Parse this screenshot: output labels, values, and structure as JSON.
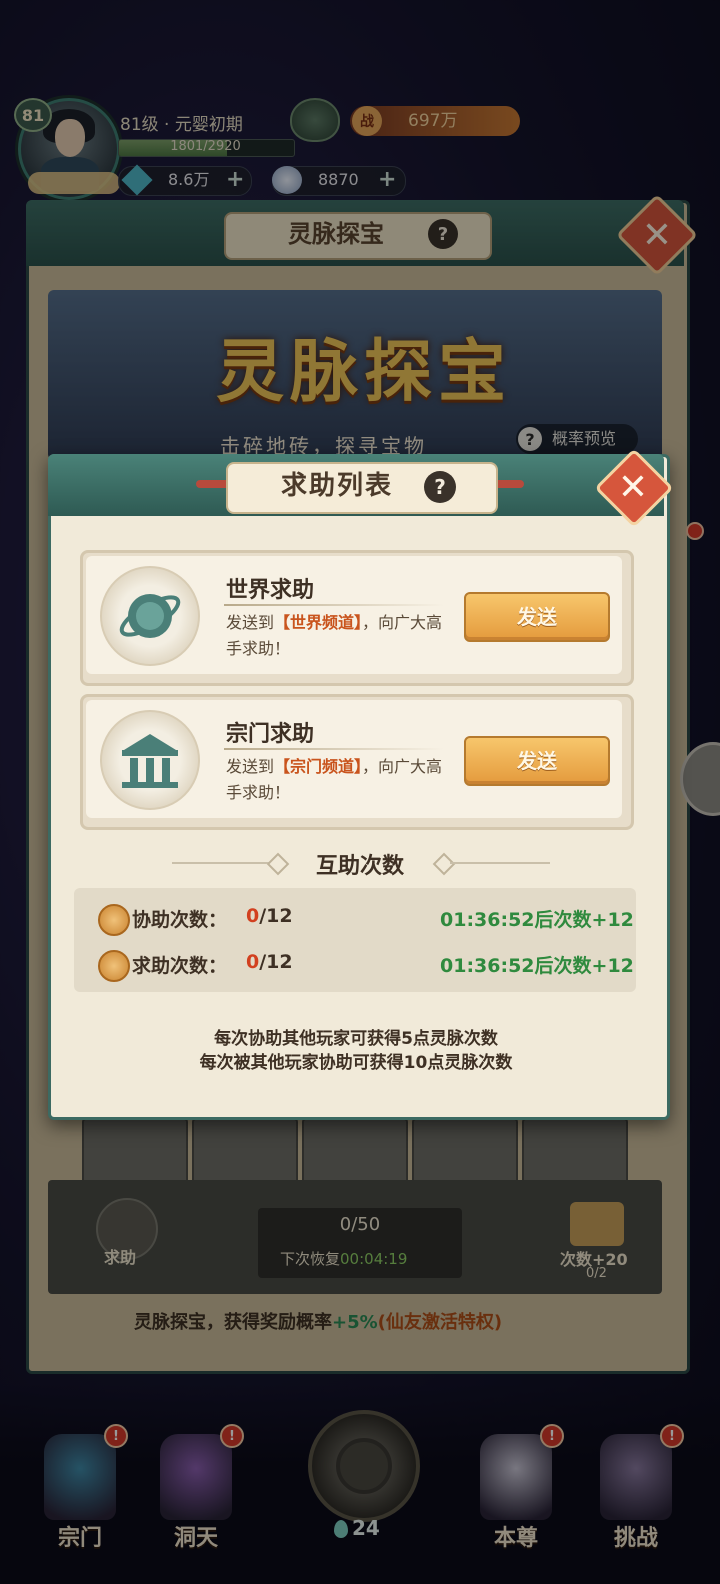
{
  "player": {
    "level_badge": "81",
    "level_text": "81级 · 元婴初期",
    "exp": {
      "current": 1801,
      "max": 2920,
      "label": "1801/2920"
    },
    "power_icon_text": "战",
    "power": "697万",
    "gems": "8.6万",
    "coins": "8870",
    "plus": "+"
  },
  "background_panel": {
    "title": "灵脉探宝",
    "help": "?",
    "close": "✕",
    "banner_title": "灵脉探宝",
    "banner_subtitle": "击碎地砖，探寻宝物",
    "prob_help": "?",
    "prob_label": "概率预览",
    "help_label": "求助",
    "counter": "0/50",
    "next_restore_label": "下次恢复",
    "next_restore_time": "00:04:19",
    "video_label": "次数+20",
    "video_sub": "0/2",
    "bonus_prefix": "灵脉探宝，获得奖励概率",
    "bonus_value": "+5%",
    "bonus_privilege": "(仙友激活特权)"
  },
  "modal": {
    "title": "求助列表",
    "help": "?",
    "close": "✕",
    "cards": [
      {
        "title": "世界求助",
        "desc_prefix": "发送到",
        "channel": "【世界频道】",
        "desc_suffix": "，向广大高手求助！",
        "button": "发送",
        "icon": "planet-icon"
      },
      {
        "title": "宗门求助",
        "desc_prefix": "发送到",
        "channel": "【宗门频道】",
        "desc_suffix": "，向广大高手求助！",
        "button": "发送",
        "icon": "pavilion-icon"
      }
    ],
    "section_title": "互助次数",
    "stats": [
      {
        "label": "协助次数：",
        "current": "0",
        "total": "/12",
        "timer": "01:36:52后次数+12"
      },
      {
        "label": "求助次数：",
        "current": "0",
        "total": "/12",
        "timer": "01:36:52后次数+12"
      }
    ],
    "notes": [
      "每次协助其他玩家可获得5点灵脉次数",
      "每次被其他玩家协助可获得10点灵脉次数"
    ]
  },
  "nav": {
    "items": [
      {
        "label": "宗门",
        "badge": "!",
        "color": "#3f8aa8"
      },
      {
        "label": "洞天",
        "badge": "!",
        "color": "#8b5fb0"
      },
      {
        "label": "本尊",
        "badge": "!",
        "color": "#c9c6d6"
      },
      {
        "label": "挑战",
        "badge": "!",
        "color": "#8a7aa0"
      }
    ],
    "center_count": "24"
  },
  "colors": {
    "accent_teal": "#3c6a62",
    "send_orange": "#e49a3c",
    "highlight_red": "#d2401f",
    "timer_green": "#2f8a3e"
  }
}
